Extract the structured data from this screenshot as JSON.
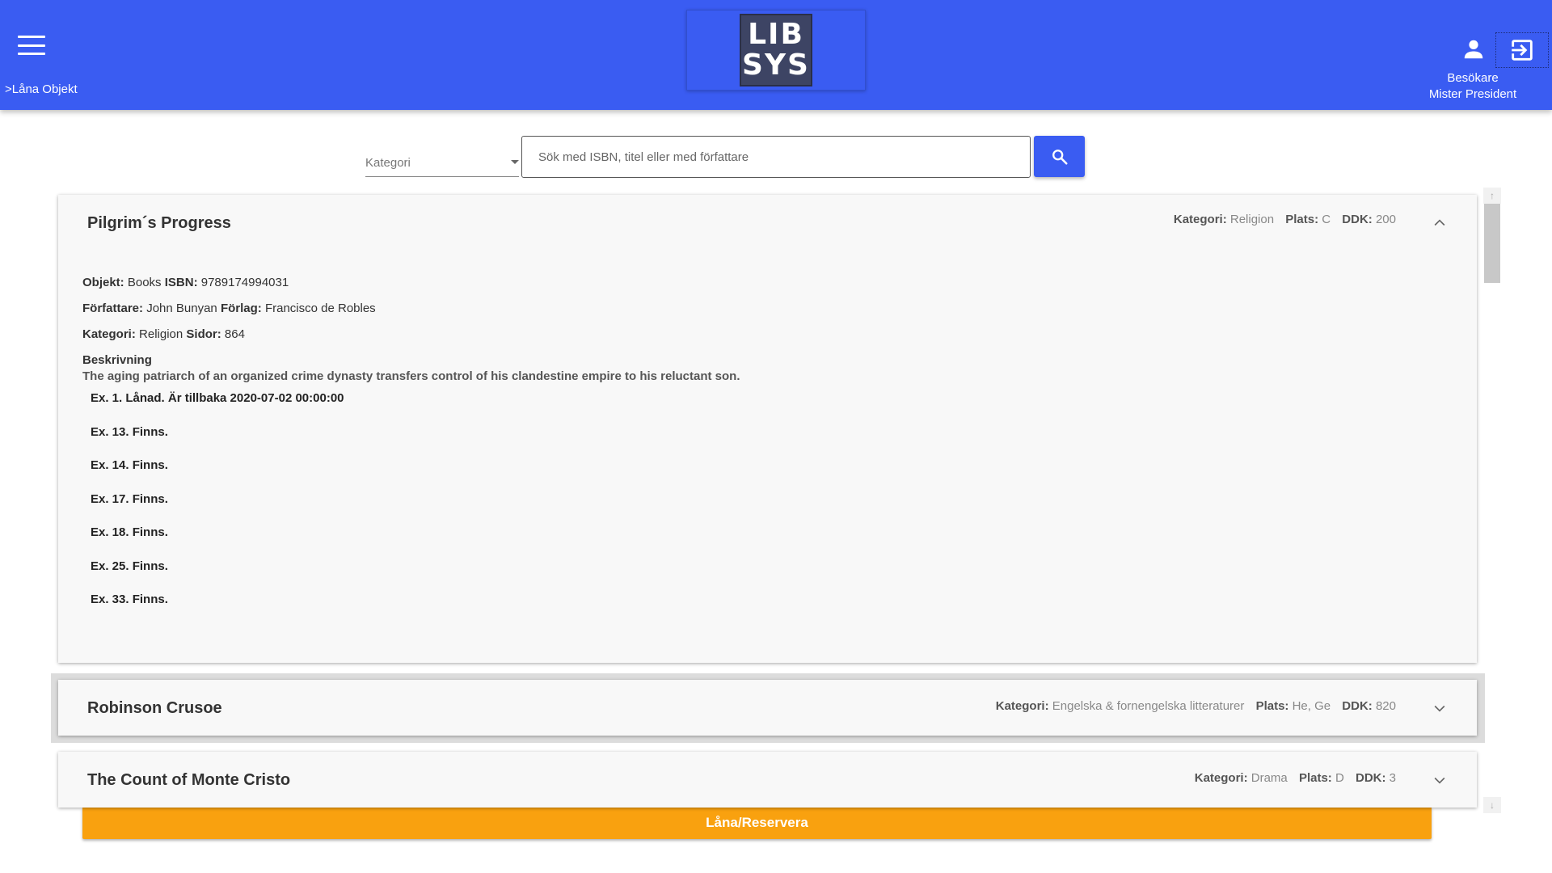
{
  "header": {
    "breadcrumb": ">Låna Objekt",
    "logo_line1": "LIB",
    "logo_line2": "SYS",
    "user_role": "Besökare",
    "user_name": "Mister President"
  },
  "search": {
    "category_placeholder": "Kategori",
    "input_placeholder": "Sök med ISBN, titel eller med författare"
  },
  "labels": {
    "kategori": "Kategori:",
    "plats": "Plats:",
    "ddk": "DDK:",
    "objekt": "Objekt:",
    "isbn": "ISBN:",
    "forfattare": "Författare:",
    "forlag": "Förlag:",
    "sidor": "Sidor:",
    "beskrivning": "Beskrivning"
  },
  "items": [
    {
      "title": "Pilgrim´s Progress",
      "kategori": "Religion",
      "plats": "C",
      "ddk": "200",
      "objekt": "Books",
      "isbn": "9789174994031",
      "forfattare": "John Bunyan",
      "forlag": "Francisco de Robles",
      "sidor": "864",
      "beskrivning": "The aging patriarch of an organized crime dynasty transfers control of his clandestine empire to his reluctant son.",
      "copies": [
        "Ex. 1. Lånad. Är tillbaka 2020-07-02 00:00:00",
        "Ex. 13. Finns.",
        "Ex. 14. Finns.",
        "Ex. 17. Finns.",
        "Ex. 18. Finns.",
        "Ex. 25. Finns.",
        "Ex. 33. Finns."
      ],
      "button_label": "Låna/Reservera"
    },
    {
      "title": "Robinson Crusoe",
      "kategori": "Engelska & fornengelska litteraturer",
      "plats": "He, Ge",
      "ddk": "820"
    },
    {
      "title": "The Count of Monte Cristo",
      "kategori": "Drama",
      "plats": "D",
      "ddk": "3"
    }
  ],
  "colors": {
    "header_bg": "#3a5cf2",
    "accent_button": "#f9a10f"
  }
}
